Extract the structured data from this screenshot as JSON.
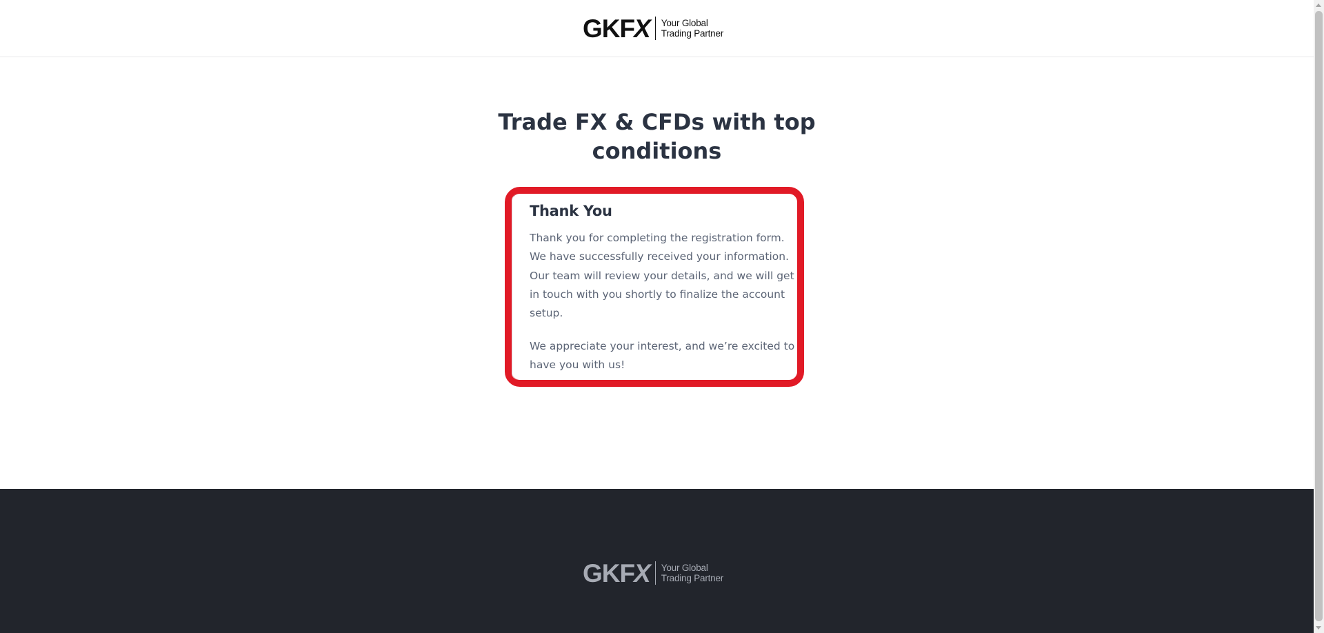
{
  "header": {
    "logo": {
      "mark": "GKF",
      "mark_x": "X",
      "tagline_line1": "Your Global",
      "tagline_line2": "Trading Partner"
    }
  },
  "main": {
    "hero_title": "Trade FX & CFDs with top conditions",
    "card": {
      "title": "Thank You",
      "paragraph1": "Thank you for completing the registration form. We have successfully received your information. Our team will review your details, and we will get in touch with you shortly to finalize the account setup.",
      "paragraph2": "We appreciate your interest, and we’re excited to have you with us!",
      "highlight_color": "#e11a26"
    }
  },
  "footer": {
    "logo": {
      "mark": "GKF",
      "mark_x": "X",
      "tagline_line1": "Your Global",
      "tagline_line2": "Trading Partner"
    },
    "background_color": "#22252c"
  }
}
